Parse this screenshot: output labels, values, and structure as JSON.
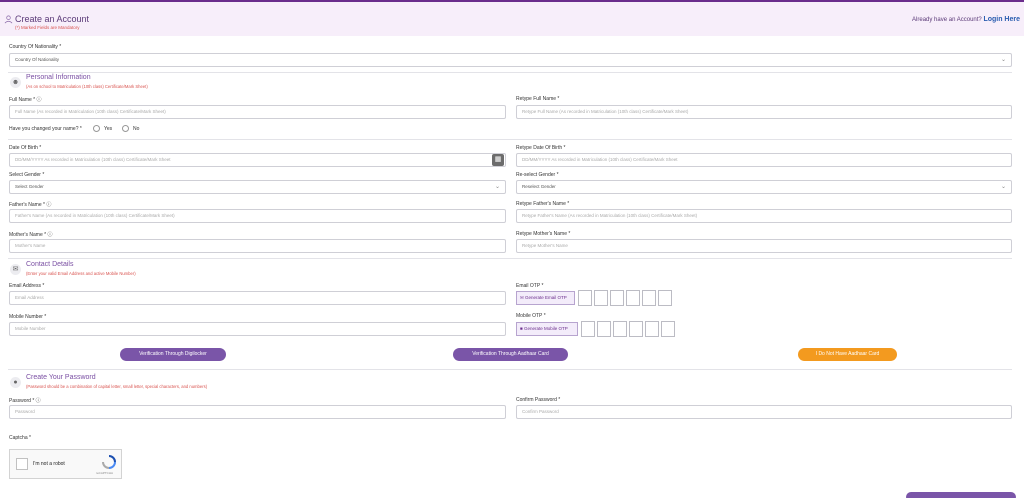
{
  "header": {
    "title": "Create an Account",
    "subtitle": "(*) Marked Fields are Mandatory",
    "login_prompt": "Already have an Account?",
    "login_link": "Login Here"
  },
  "nationality": {
    "label": "Country Of Nationality *",
    "value": "Country Of Nationality"
  },
  "personal": {
    "title": "Personal Information",
    "note": "(As on school to Matriculation (10th class) Certificate/Mark Sheet)",
    "full_name_label": "Full Name * ⓘ",
    "full_name_placeholder": "Full Name (As recorded in Matriculation (10th class) Certificate/Mark Sheet)",
    "retype_full_name_label": "Retype Full Name *",
    "retype_full_name_placeholder": "Retype Full Name (As recorded in Matriculation (10th class) Certificate/Mark Sheet)",
    "changed_name_label": "Have you changed your name? *",
    "yes_label": "Yes",
    "no_label": "No",
    "dob_label": "Date Of Birth *",
    "dob_placeholder": "DD/MM/YYYY As recorded in Matriculation (10th class) Certificate/Mark Sheet",
    "retype_dob_label": "Retype Date Of Birth *",
    "retype_dob_placeholder": "DD/MM/YYYY As recorded in Matriculation (10th class) Certificate/Mark Sheet",
    "gender_label": "Select Gender *",
    "gender_value": "Select Gender",
    "retype_gender_label": "Re-select Gender *",
    "retype_gender_value": "Reselect Gender",
    "father_label": "Father's Name * ⓘ",
    "father_placeholder": "Father's Name (As recorded in Matriculation (10th class) Certificate/Mark Sheet)",
    "retype_father_label": "Retype Father's Name *",
    "retype_father_placeholder": "Retype Father's Name (As recorded in Matriculation (10th class) Certificate/Mark Sheet)",
    "mother_label": "Mother's Name * ⓘ",
    "mother_placeholder": "Mother's Name",
    "retype_mother_label": "Retype Mother's Name *",
    "retype_mother_placeholder": "Retype Mother's Name"
  },
  "contact": {
    "title": "Contact Details",
    "note": "(Enter your valid Email Address and active Mobile Number)",
    "email_label": "Email Address *",
    "email_placeholder": "Email Address",
    "email_otp_label": "Email OTP *",
    "email_otp_button": "Generate Email OTP",
    "mobile_label": "Mobile Number *",
    "mobile_placeholder": "Mobile Number",
    "mobile_otp_label": "Mobile OTP *",
    "mobile_otp_button": "Generate Mobile OTP"
  },
  "verification": {
    "digilocker": "Verification Through Digilocker",
    "aadhaar": "Verification Through Aadhaar Card",
    "no_aadhaar": "I Do Not Have Aadhaar Card"
  },
  "password": {
    "title": "Create Your Password",
    "note": "(Password should be a combination of capital letter, small letter, special characters, and numbers)",
    "password_label": "Password * ⓘ",
    "password_placeholder": "Password",
    "confirm_label": "Confirm Password *",
    "confirm_placeholder": "Confirm Password"
  },
  "captcha": {
    "label": "Captcha *",
    "checkbox_text": "I'm not a robot",
    "brand": "reCAPTCHA"
  },
  "colors": {
    "accent": "#7a55a8",
    "orange": "#f39a1f",
    "mandatory": "#d9534f",
    "header_bg": "#f7eefa"
  }
}
